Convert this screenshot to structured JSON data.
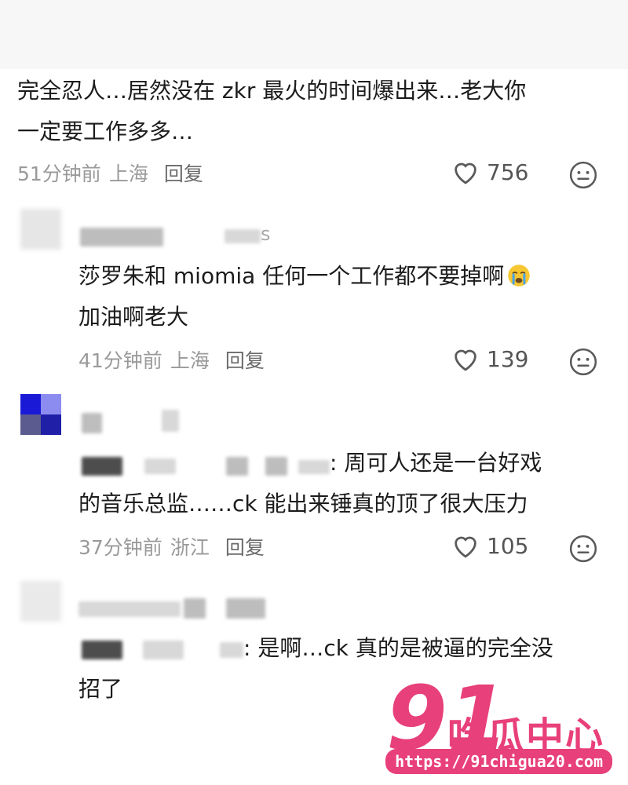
{
  "comments": [
    {
      "text_line1": "完全忍人…居然没在 zkr 最火的时间爆出来…老大你",
      "text_line2": "一定要工作多多…",
      "time": "51分钟前",
      "location": "上海",
      "reply_label": "回复",
      "likes": "756"
    },
    {
      "username_suffix": "s",
      "text_line1": "莎罗朱和 miomia 任何一个工作都不要掉啊",
      "text_line2": "加油啊老大",
      "time": "41分钟前",
      "location": "上海",
      "reply_label": "回复",
      "likes": "139"
    },
    {
      "text_line1_tail": ": 周可人还是一台好戏",
      "text_line2": "的音乐总监……ck 能出来锤真的顶了很大压力",
      "time": "37分钟前",
      "location": "浙江",
      "reply_label": "回复",
      "likes": "105"
    },
    {
      "text_line1_tail": ": 是啊…ck 真的是被逼的完全没",
      "text_line2": "招了"
    }
  ],
  "watermark": {
    "brand_number": "91",
    "brand_title": "吃瓜中心",
    "url": "https://91chigua20.com",
    "color": "#e8407a"
  },
  "icons": {
    "like": "heart-outline-icon",
    "emoji": "smiley-emoji-icon",
    "crying": "crying-emoji-icon"
  }
}
